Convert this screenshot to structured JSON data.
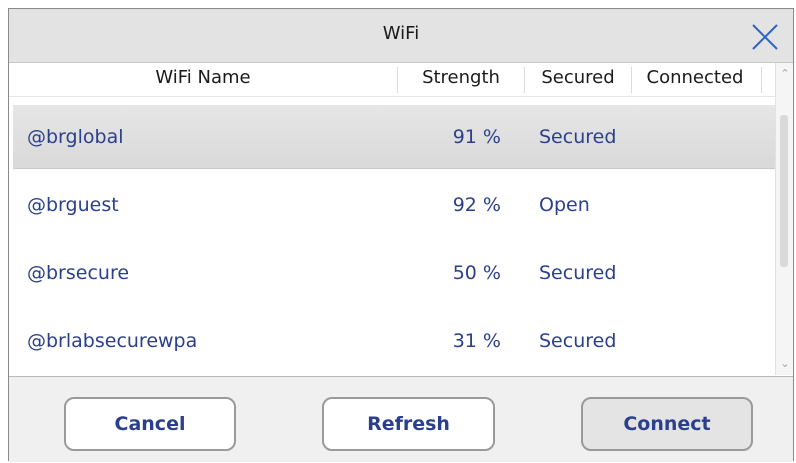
{
  "window": {
    "title": "WiFi",
    "close_icon": "close-x-icon"
  },
  "columns": {
    "name": "WiFi Name",
    "strength": "Strength",
    "secured": "Secured",
    "connected": "Connected"
  },
  "networks": [
    {
      "name": "@brglobal",
      "strength": "91 %",
      "security": "Secured",
      "connected": "",
      "selected": true
    },
    {
      "name": "@brguest",
      "strength": "92 %",
      "security": "Open",
      "connected": "",
      "selected": false
    },
    {
      "name": "@brsecure",
      "strength": "50 %",
      "security": "Secured",
      "connected": "",
      "selected": false
    },
    {
      "name": "@brlabsecurewpa",
      "strength": "31 %",
      "security": "Secured",
      "connected": "",
      "selected": false
    }
  ],
  "buttons": {
    "cancel": "Cancel",
    "refresh": "Refresh",
    "connect": "Connect"
  },
  "colors": {
    "accent_text": "#2b3f8c",
    "close_icon": "#2b62c7"
  }
}
